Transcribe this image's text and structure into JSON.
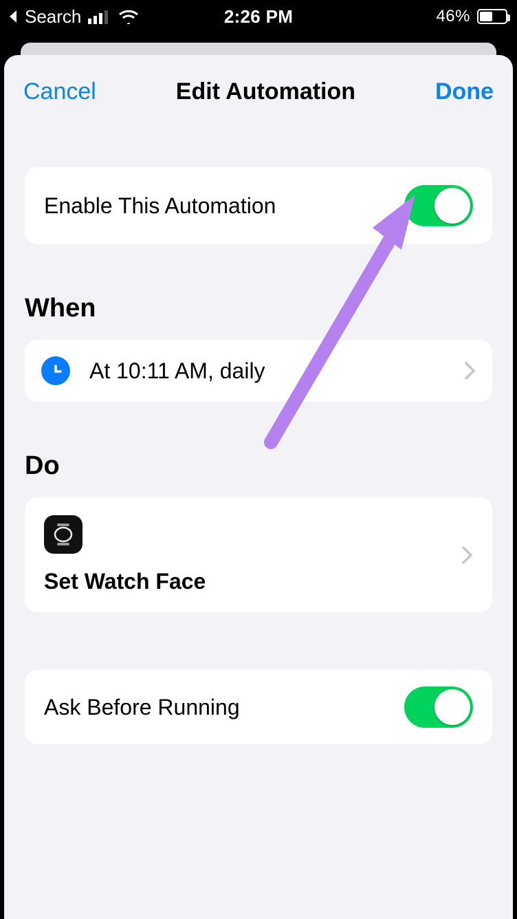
{
  "status": {
    "back_label": "Search",
    "time": "2:26 PM",
    "battery_text": "46%",
    "battery_level": 0.46
  },
  "nav": {
    "cancel": "Cancel",
    "title": "Edit Automation",
    "done": "Done"
  },
  "enable": {
    "label": "Enable This Automation",
    "value": true
  },
  "sections": {
    "when": "When",
    "do": "Do"
  },
  "when_row": {
    "label": "At 10:11 AM, daily"
  },
  "do_row": {
    "action_label": "Set Watch Face"
  },
  "ask": {
    "label": "Ask Before Running",
    "value": true
  }
}
